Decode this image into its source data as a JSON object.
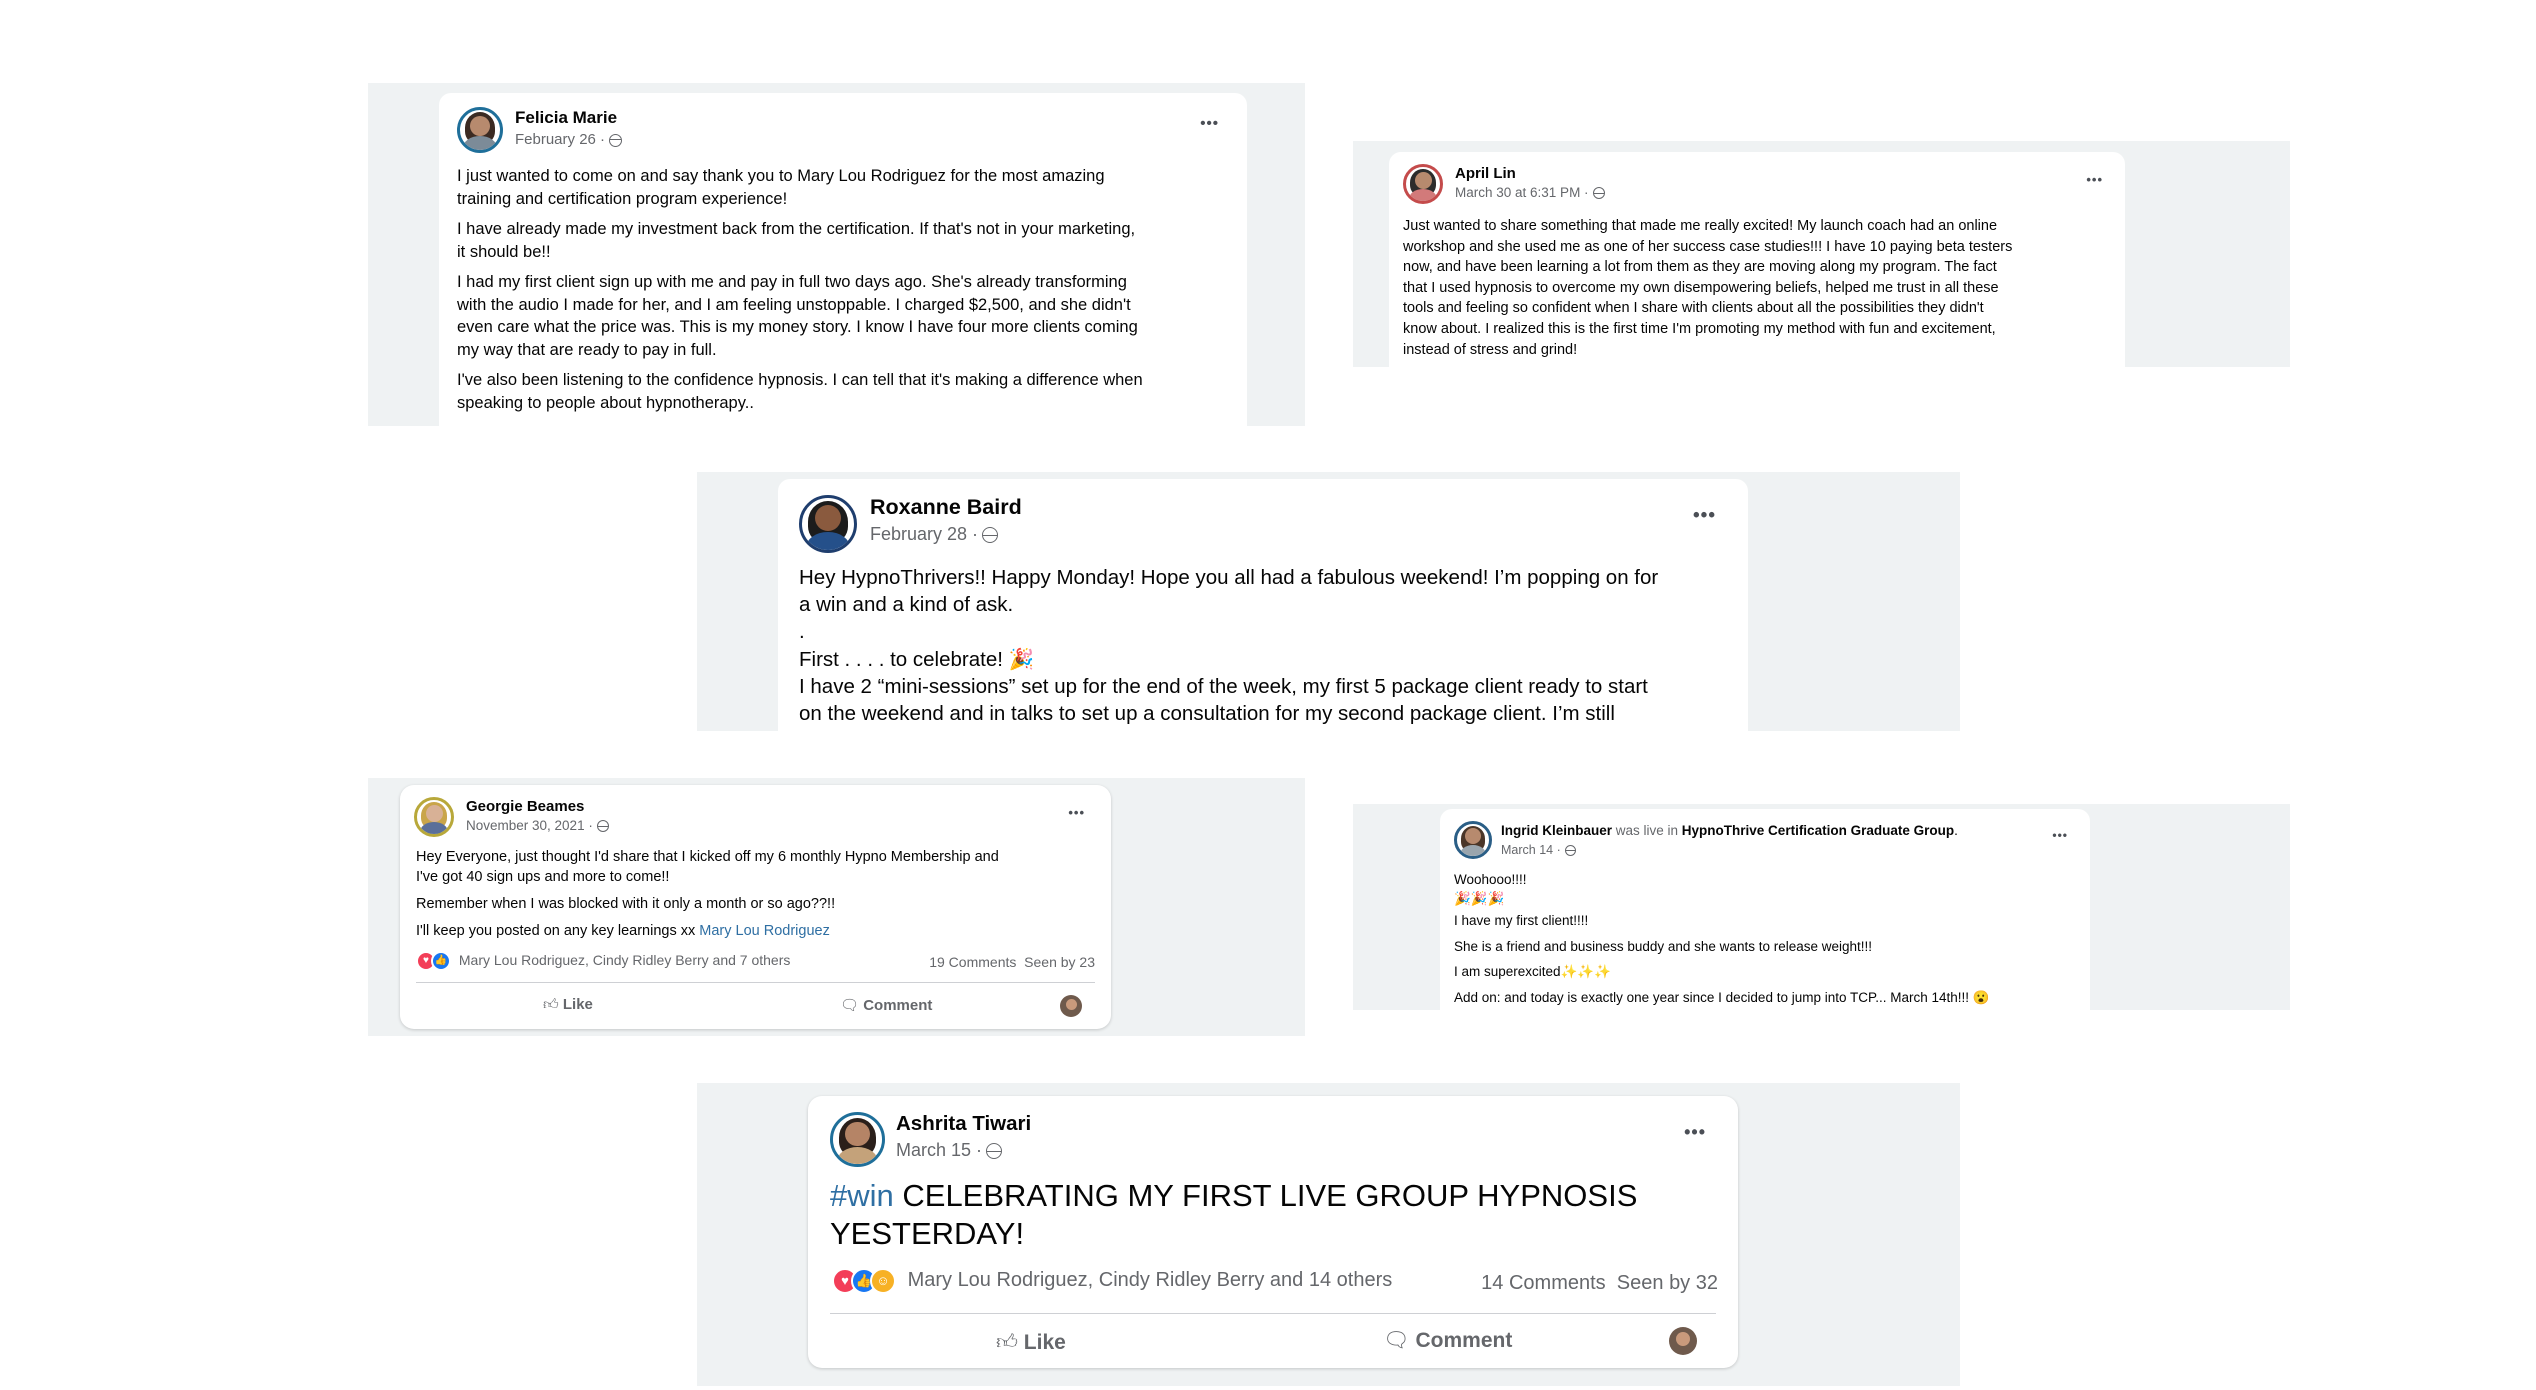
{
  "posts": {
    "felicia": {
      "name": "Felicia Marie",
      "date": "February 26 ·",
      "paragraphs": [
        [
          "I just wanted to come on and say thank you to Mary Lou Rodriguez for the most amazing",
          "training and certification program experience!"
        ],
        [
          "I have already made my investment back from the certification. If that's not in your marketing,",
          "it should be!!"
        ],
        [
          "I had my first client sign up with me and pay in full two days ago. She's already transforming",
          "with the audio I made for her, and I am feeling unstoppable. I charged $2,500, and she didn't",
          "even care what the price was. This is my money story. I know I have four more clients coming",
          "my way that are ready to pay in full."
        ],
        [
          "I've also been listening to the confidence hypnosis. I can tell that it's making a difference when",
          "speaking to people about hypnotherapy.."
        ]
      ]
    },
    "april": {
      "name": "April Lin",
      "date": "March 30 at 6:31 PM ·",
      "lines": [
        "Just wanted to share something that made me really excited! My launch coach had an online",
        "workshop and she used me as one of her success case studies!!! I have 10 paying beta testers",
        "now, and have been learning a lot from them as they are moving along my program. The fact",
        "that I used hypnosis to overcome my own disempowering beliefs, helped me trust in all these",
        "tools and feeling so confident when I share with clients about all the possibilities they didn't",
        "know about. I realized this is the first time I'm promoting my method with fun and excitement,",
        "instead of stress and grind!"
      ]
    },
    "roxanne": {
      "name": "Roxanne Baird",
      "date": "February 28 ·",
      "lines": [
        "Hey HypnoThrivers!! Happy Monday! Hope you all had a fabulous weekend! I’m popping on for",
        "a win and a kind of ask.",
        ".",
        "First . . . . to celebrate! 🎉",
        "I have 2 “mini-sessions” set up for the end of the week, my first 5 package client ready to start",
        "on the weekend and in talks to set up a consultation for my second package client. I’m still"
      ]
    },
    "georgie": {
      "name": "Georgie Beames",
      "date": "November 30, 2021 ·",
      "lines": [
        "Hey Everyone, just thought I'd share that I kicked off my 6 monthly Hypno Membership and",
        "I've got 40 sign ups and more to come!!"
      ],
      "line2": "Remember when I was blocked with it only a month or so ago??!!",
      "line3_prefix": "I'll keep you posted on any key learnings xx ",
      "line3_link": "Mary Lou Rodriguez",
      "reactors": "Mary Lou Rodriguez, Cindy Ridley Berry and 7 others",
      "comments": "19 Comments",
      "seen": "Seen by 23",
      "like_label": "Like",
      "comment_label": "Comment"
    },
    "ingrid": {
      "name": "Ingrid Kleinbauer",
      "was_live": " was live in ",
      "group": "HypnoThrive Certification Graduate Group",
      "date": "March 14 ·",
      "lines": [
        "Woohooo!!!!",
        "🎉🎉🎉",
        "I have my first client!!!!",
        "She is a friend and business buddy and she wants to release weight!!!",
        "I am superexcited✨✨✨",
        "Add on: and today is exactly one year since I decided to jump into TCP... March 14th!!! 😮"
      ]
    },
    "ashrita": {
      "name": "Ashrita Tiwari",
      "date": "March 15 ·",
      "hashtag": "#win",
      "headline_1": " CELEBRATING MY FIRST LIVE GROUP HYPNOSIS",
      "headline_2": "YESTERDAY!",
      "reactors": "Mary Lou Rodriguez, Cindy Ridley Berry and 14 others",
      "comments": "14 Comments",
      "seen": "Seen by 32",
      "like_label": "Like",
      "comment_label": "Comment"
    }
  },
  "icons": {
    "more": "•••",
    "globe": "globe-icon",
    "like": "thumbs-up-icon",
    "comment": "speech-bubble-icon"
  },
  "colors": {
    "panel": "#eff2f3",
    "link": "#2f6fa3",
    "meta": "#65676b",
    "love": "#f33e58",
    "like": "#1877f2",
    "care": "#f7b125"
  }
}
